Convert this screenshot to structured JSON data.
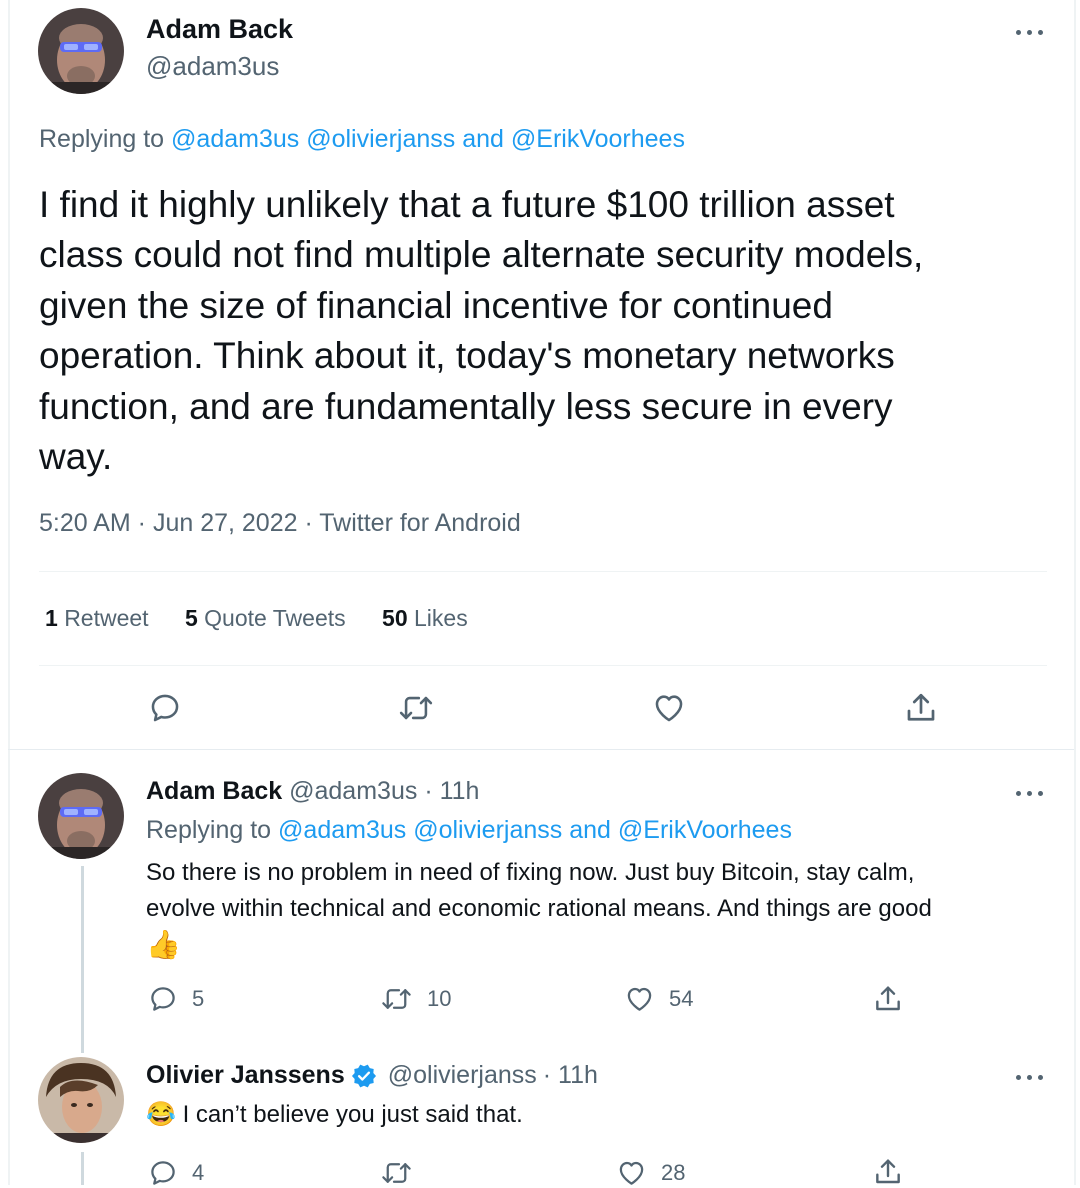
{
  "main_tweet": {
    "author_name": "Adam Back",
    "handle": "@adam3us",
    "replying_prefix": "Replying to",
    "replying_to": [
      "@adam3us",
      "@olivierjanss",
      "and",
      "@ErikVoorhees"
    ],
    "body_lines": [
      "I find it highly unlikely that a future $100 trillion asset",
      "class could not find multiple alternate security models,",
      "given the size of financial incentive for continued",
      "operation. Think about it, today's monetary networks",
      "function, and are fundamentally less secure in every",
      "way."
    ],
    "timestamp": "5:20 AM · Jun 27, 2022 · Twitter for Android",
    "stats": {
      "retweets_count": "1",
      "retweets_label": "Retweet",
      "quotes_count": "5",
      "quotes_label": "Quote Tweets",
      "likes_count": "50",
      "likes_label": "Likes"
    }
  },
  "reply_1": {
    "author_name": "Adam Back",
    "handle": "@adam3us",
    "time": "· 11h",
    "replying_prefix": "Replying to",
    "replying_to": [
      "@adam3us",
      "@olivierjanss",
      "and",
      "@ErikVoorhees"
    ],
    "body_lines": [
      "So there is no problem in need of fixing now. Just buy Bitcoin, stay calm,",
      "evolve within technical and economic rational means. And things are good"
    ],
    "emoji": "👍",
    "actions": {
      "replies": "5",
      "retweets": "10",
      "likes": "54"
    }
  },
  "reply_2": {
    "author_name": "Olivier Janssens",
    "handle": "@olivierjanss",
    "time": "· 11h",
    "verified": true,
    "emoji": "😂",
    "body": "I can’t believe you just said that.",
    "actions": {
      "replies": "4",
      "retweets": "",
      "likes": "28"
    }
  },
  "colors": {
    "accent": "#1d9bf0",
    "text": "#0f1419",
    "muted": "#536471",
    "divider": "#eff3f4"
  }
}
